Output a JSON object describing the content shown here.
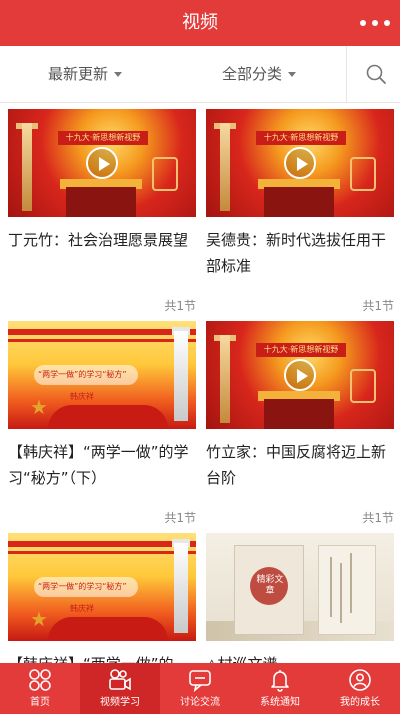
{
  "header": {
    "title": "视频"
  },
  "filters": {
    "latest_label": "最新更新",
    "category_label": "全部分类"
  },
  "cards": [
    {
      "title": "丁元竹：社会治理愿景展望",
      "count": "共1节",
      "thumb_text": "十九大·新思想新视野"
    },
    {
      "title": "吴德贵：新时代选拔任用干部标准",
      "count": "共1节",
      "thumb_text": "十九大·新思想新视野"
    },
    {
      "title": "【韩庆祥】“两学一做”的学习“秘方”（下）",
      "count": "共1节",
      "thumb_text": "“两学一做”的学习“秘方”",
      "thumb_sub": "韩庆祥"
    },
    {
      "title": "竹立家：中国反腐将迈上新台阶",
      "count": "共1节",
      "thumb_text": "十九大·新思想新视野"
    },
    {
      "title": "【韩庆祥】“两学一做”的",
      "count": "",
      "thumb_text": "“两学一做”的学习“秘方”",
      "thumb_sub": "韩庆祥"
    },
    {
      "title": "△村巡文谱",
      "count": "",
      "thumb_text": "精彩文章"
    }
  ],
  "tabs": [
    {
      "label": "首页",
      "icon": "home-grid-icon"
    },
    {
      "label": "视频学习",
      "icon": "video-camera-icon"
    },
    {
      "label": "讨论交流",
      "icon": "chat-bubble-icon"
    },
    {
      "label": "系统通知",
      "icon": "bell-icon"
    },
    {
      "label": "我的成长",
      "icon": "user-icon"
    }
  ],
  "colors": {
    "brand_red": "#e33a3a",
    "active_tab": "#cf2727",
    "text_primary": "#222222",
    "text_secondary": "#888888"
  }
}
